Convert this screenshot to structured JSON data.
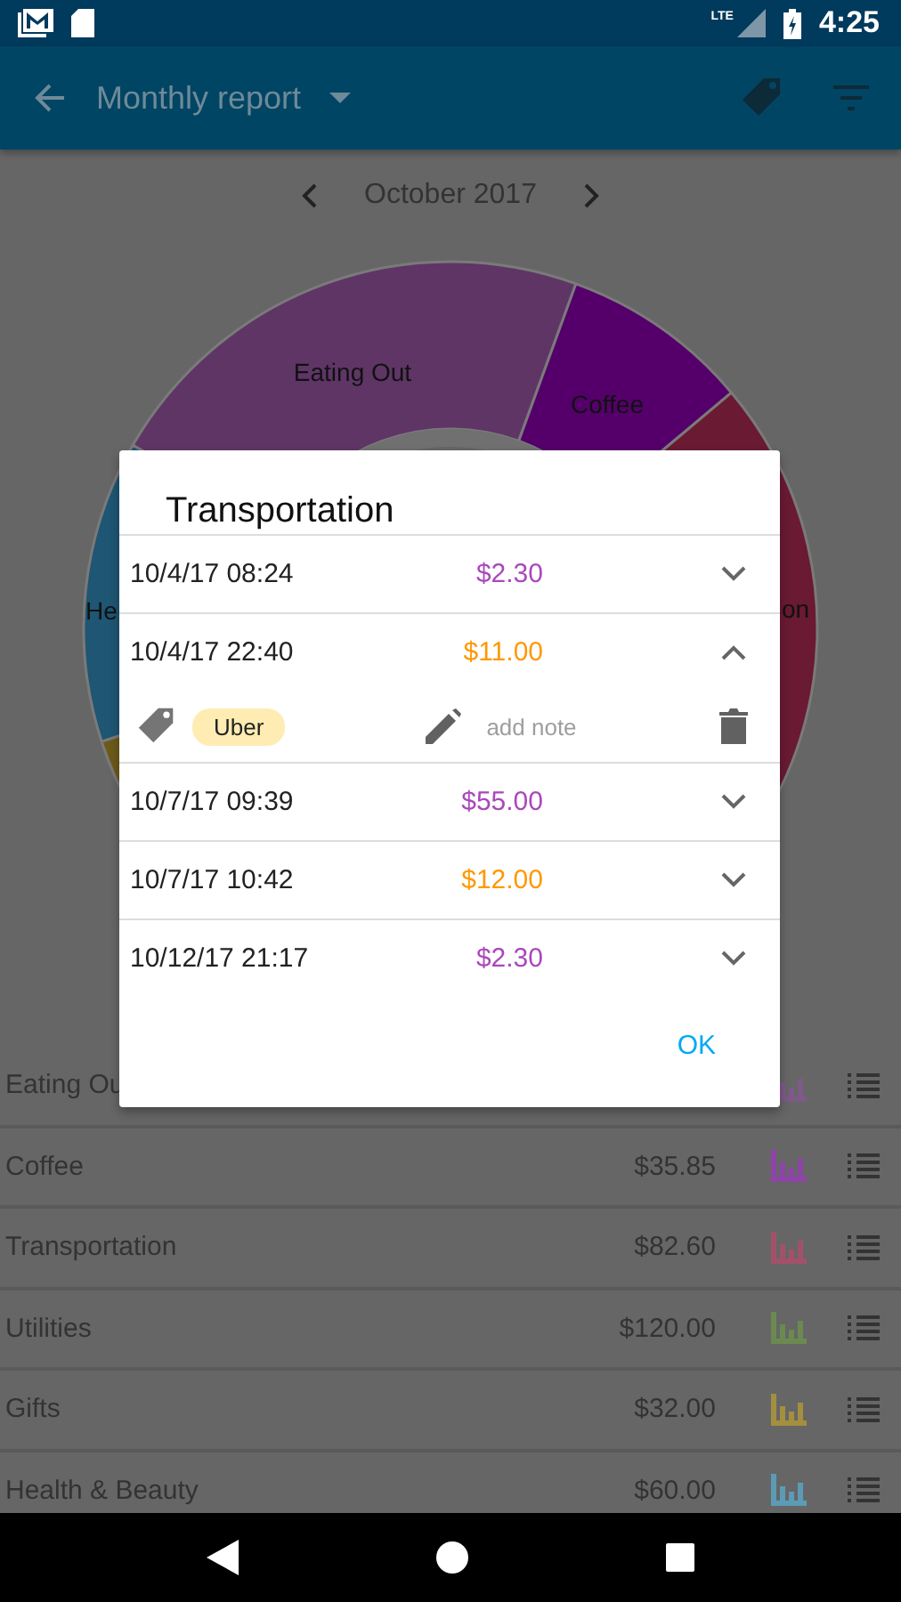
{
  "status_bar": {
    "network": "LTE",
    "time": "4:25"
  },
  "app_bar": {
    "title": "Monthly report"
  },
  "month_nav": {
    "label": "October 2017"
  },
  "pie": {
    "slices": [
      {
        "label": "He",
        "color": "#1e5673"
      },
      {
        "label": "Eating Out",
        "color": "#5f3566"
      },
      {
        "label": "Coffee",
        "color": "#55006a"
      },
      {
        "label": "on",
        "color": "#6a1a33"
      },
      {
        "color": "#6b5a1a"
      }
    ]
  },
  "categories": [
    {
      "name": "Eating Ou",
      "color": "#7d5a88"
    },
    {
      "name": "Coffee",
      "amount": "$35.85",
      "color": "#8e44a6"
    },
    {
      "name": "Transportation",
      "amount": "$82.60",
      "color": "#a3516a"
    },
    {
      "name": "Utilities",
      "amount": "$120.00",
      "color": "#6a8a4f"
    },
    {
      "name": "Gifts",
      "amount": "$32.00",
      "color": "#a48f3f"
    },
    {
      "name": "Health & Beauty",
      "amount": "$60.00",
      "color": "#5b9bb5"
    }
  ],
  "dialog": {
    "title": "Transportation",
    "entries": [
      {
        "date": "10/4/17  08:24",
        "amount": "$2.30",
        "color": "#ab47bc",
        "expanded": false
      },
      {
        "date": "10/4/17  22:40",
        "amount": "$11.00",
        "color": "#ff9800",
        "expanded": true,
        "tag": "Uber",
        "note_placeholder": "add note"
      },
      {
        "date": "10/7/17  09:39",
        "amount": "$55.00",
        "color": "#ab47bc",
        "expanded": false
      },
      {
        "date": "10/7/17  10:42",
        "amount": "$12.00",
        "color": "#ff9800",
        "expanded": false
      },
      {
        "date": "10/12/17  21:17",
        "amount": "$2.30",
        "color": "#ab47bc",
        "expanded": false
      }
    ],
    "button": "OK"
  }
}
